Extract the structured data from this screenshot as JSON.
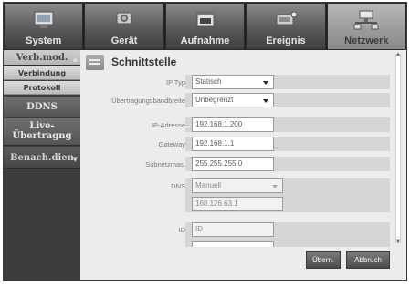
{
  "tabs": [
    {
      "label": "System",
      "icon": "system-icon"
    },
    {
      "label": "Gerät",
      "icon": "camera-icon"
    },
    {
      "label": "Aufnahme",
      "icon": "record-icon"
    },
    {
      "label": "Ereignis",
      "icon": "event-icon"
    },
    {
      "label": "Netzwerk",
      "icon": "network-icon"
    }
  ],
  "sidebar": {
    "items": [
      {
        "label": "Verb.mod."
      },
      {
        "label": "Verbindung"
      },
      {
        "label": "Protokoll"
      },
      {
        "label": "DDNS"
      },
      {
        "label": "Live-"
      },
      {
        "label": "Übertragng"
      },
      {
        "label": "Benach.dien"
      }
    ]
  },
  "panel": {
    "title": "Schnittstelle",
    "fields": {
      "ip_type": {
        "label": "IP Typ",
        "value": "Statisch"
      },
      "bandwidth": {
        "label": "Übertragungsbandbreite",
        "value": "Unbegrenzt"
      },
      "ip_address": {
        "label": "IP-Adresse",
        "value": "192.168.1.200"
      },
      "gateway": {
        "label": "Gateway",
        "value": "192.168.1.1"
      },
      "subnet": {
        "label": "Subnetzmas.",
        "value": "255.255.255.0"
      },
      "dns": {
        "label": "DNS",
        "value": "Manuell",
        "server": "168.126.63.1"
      },
      "id": {
        "label": "ID",
        "placeholder": "ID"
      }
    }
  },
  "buttons": {
    "apply": "Übern.",
    "cancel": "Abbruch"
  },
  "colors": {
    "active_tab": "#9a9a9a",
    "panel_bg": "#ececec",
    "sidebar_bg": "#3d3d3d"
  }
}
